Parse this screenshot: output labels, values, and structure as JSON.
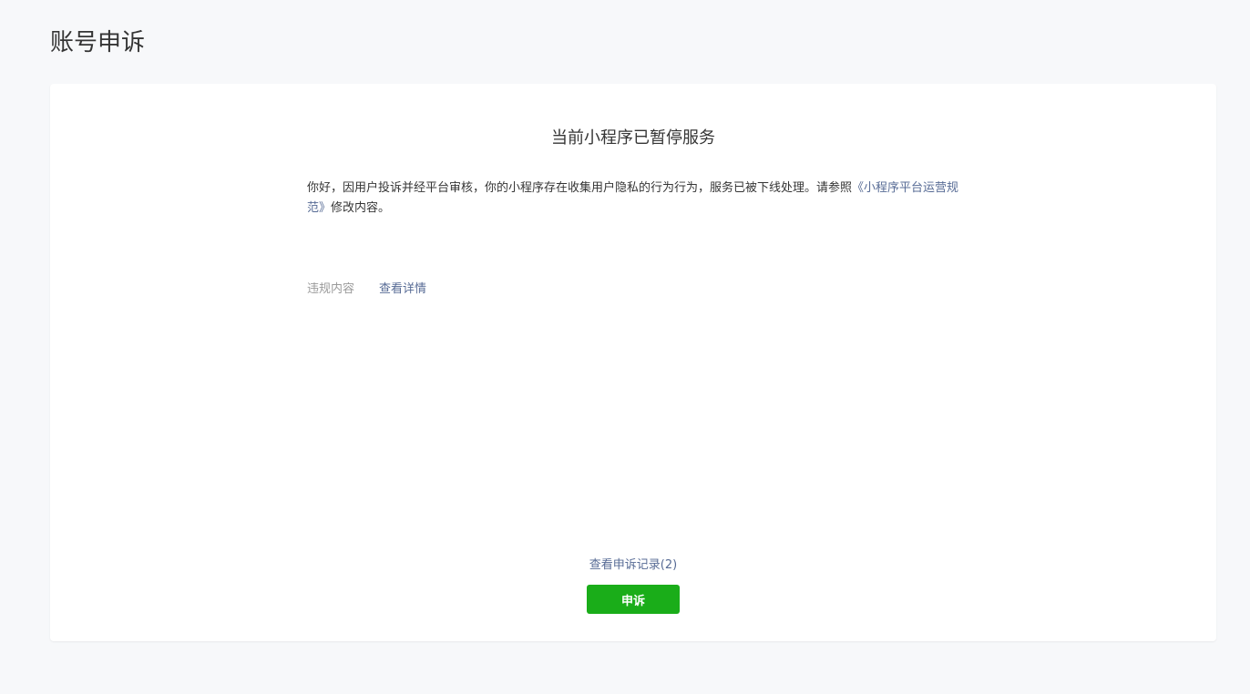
{
  "header": {
    "title": "账号申诉"
  },
  "notice": {
    "title": "当前小程序已暂停服务",
    "body_text": "你好，因用户投诉并经平台审核，你的小程序存在收集用户隐私的行为行为，服务已被下线处理。请参照",
    "policy_link": "《小程序平台运营规范》",
    "body_suffix": "修改内容。"
  },
  "violation": {
    "label": "违规内容",
    "details_link": "查看详情"
  },
  "footer": {
    "records_link": "查看申诉记录(2)",
    "appeal_button": "申诉"
  },
  "colors": {
    "background": "#f7f8fa",
    "card": "#ffffff",
    "link": "#576b95",
    "primary_button": "#1aad19",
    "muted_text": "#9a9a9a"
  }
}
